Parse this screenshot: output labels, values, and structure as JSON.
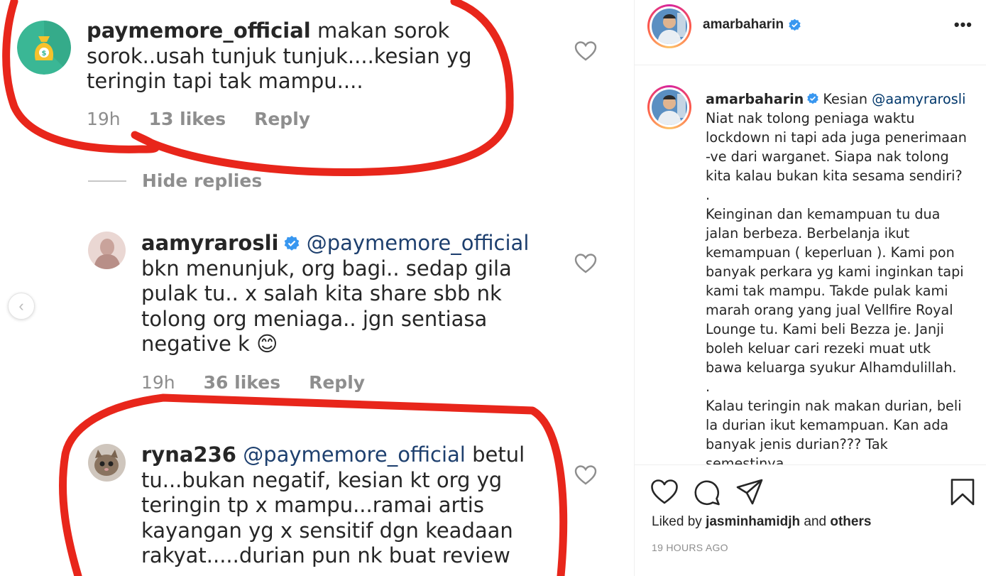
{
  "comments_image": {
    "comment1": {
      "username": "paymemore_official",
      "text": "makan sorok sorok..usah tunjuk tunjuk....kesian yg teringin tapi tak mampu....",
      "time": "19h",
      "likes": "13 likes",
      "reply": "Reply"
    },
    "hide_replies": "Hide replies",
    "comment2": {
      "username": "aamyrarosli",
      "mention": "@paymemore_official",
      "text": "bkn menunjuk, org bagi.. sedap gila pulak tu.. x salah kita share sbb nk tolong org meniaga.. jgn sentiasa negative k",
      "emoji": "😊",
      "time": "19h",
      "likes": "36 likes",
      "reply": "Reply"
    },
    "comment3": {
      "username": "ryna236",
      "mention": "@paymemore_official",
      "text": "betul tu...bukan negatif, kesian kt org yg teringin tp x mampu...ramai artis kayangan yg x sensitif dgn keadaan rakyat.....durian pun nk buat review"
    },
    "prev_glyph": "‹"
  },
  "panel": {
    "header": {
      "username": "amarbaharin",
      "more": "•••"
    },
    "caption": {
      "username": "amarbaharin",
      "lead": "Kesian",
      "mention": "@aamyrarosli",
      "lines": [
        "Niat nak tolong peniaga waktu lockdown ni tapi ada juga penerimaan -ve dari warganet. Siapa nak tolong kita kalau bukan kita sesama sendiri?",
        ".",
        "Keinginan dan kemampuan tu dua jalan berbeza. Berbelanja ikut kemampuan ( keperluan ). Kami pon banyak perkara yg kami inginkan tapi kami tak mampu. Takde pulak kami marah orang yang jual Vellfire Royal Lounge tu. Kami beli Bezza je. Janji boleh keluar cari rezeki muat utk bawa keluarga syukur Alhamdulillah.",
        ".",
        "Kalau teringin nak makan durian, beli la durian ikut kemampuan. Kan ada banyak jenis durian??? Tak semestinya"
      ]
    },
    "actions": {
      "liked_prefix": "Liked by",
      "liked_user": "jasminhamidjh",
      "liked_and": "and",
      "liked_others": "others",
      "time": "19 HOURS AGO"
    }
  },
  "icons": {
    "like": "heart-icon",
    "comment": "comment-icon",
    "share": "paper-plane-icon",
    "save": "bookmark-icon",
    "verified": "verified-badge-icon"
  },
  "colors": {
    "verified_blue": "#3897f0",
    "mention_blue": "#00376b",
    "annotation_red": "#e8261b",
    "meta_gray": "#8e8e8e"
  }
}
